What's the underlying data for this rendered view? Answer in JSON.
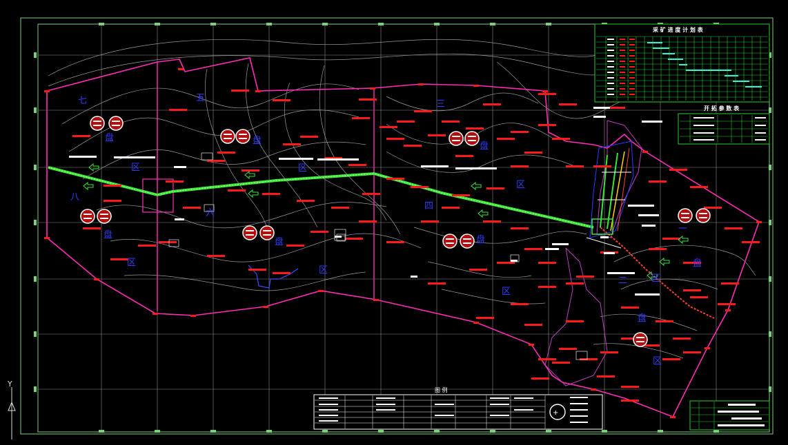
{
  "colors": {
    "background": "#000000",
    "frame": "#7cd07c",
    "grid": "#8c8c8c",
    "contour": "#9a9a9a",
    "boundary": "#ff2db4",
    "pipeline": "#39e639",
    "zone_label": "#2f3cff",
    "annotation": "#ff1a1a",
    "table_lines": "#2bd12b",
    "schedule_bar": "#3ef0d0"
  },
  "zone_labels": [
    {
      "text": "七"
    },
    {
      "text": "五"
    },
    {
      "text": "盘"
    },
    {
      "text": "区"
    },
    {
      "text": "盘"
    },
    {
      "text": "区"
    },
    {
      "text": "三"
    },
    {
      "text": "盘"
    },
    {
      "text": "区"
    },
    {
      "text": "八"
    },
    {
      "text": "盘"
    },
    {
      "text": "区"
    },
    {
      "text": "六"
    },
    {
      "text": "盘"
    },
    {
      "text": "区"
    },
    {
      "text": "四"
    },
    {
      "text": "盘"
    },
    {
      "text": "区"
    },
    {
      "text": "一"
    },
    {
      "text": "盘"
    },
    {
      "text": "区"
    },
    {
      "text": "二"
    },
    {
      "text": "盘"
    },
    {
      "text": "区"
    }
  ],
  "panels": {
    "schedule_title": "采 矿 进 度 计 划 表",
    "params_title": "开 拓 参 数 表",
    "legend_title": "图   例"
  },
  "axis": {
    "y_label": "Y"
  }
}
